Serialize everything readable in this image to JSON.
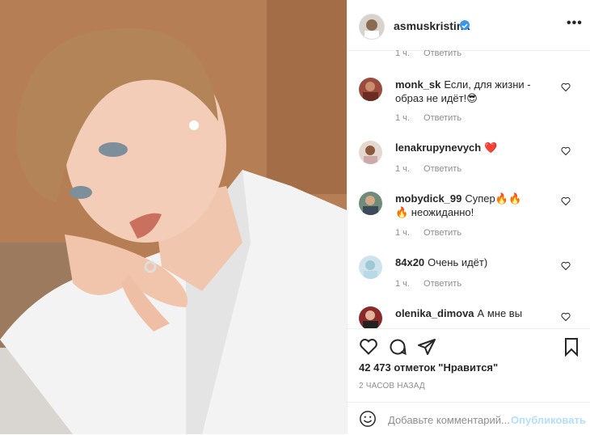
{
  "post": {
    "username": "asmuskristina",
    "more_label": "•••",
    "likes": "42 473 отметок \"Нравится\"",
    "time_ago": "2 ЧАСОВ НАЗАД",
    "add_comment_placeholder": "Добавьте комментарий...",
    "publish_label": "Опубликовать"
  },
  "comments": [
    {
      "meta_time": "1 ч.",
      "reply": "Ответить"
    },
    {
      "user": "monk_sk",
      "text": "Если, для жизни - образ не идёт!😎",
      "time": "1 ч.",
      "reply": "Ответить"
    },
    {
      "user": "lenakrupynevych",
      "text": "❤️",
      "time": "1 ч.",
      "reply": "Ответить"
    },
    {
      "user": "mobydick_99",
      "text": "Супер🔥🔥🔥 неожиданно!",
      "time": "1 ч.",
      "reply": "Ответить"
    },
    {
      "user": "84x20",
      "text": "Очень идёт)",
      "time": "1 ч.",
      "reply": "Ответить"
    },
    {
      "user": "olenika_dimova",
      "text": "А мне вы"
    }
  ],
  "colors": {
    "accent": "#3897f0",
    "heart": "#ed4956",
    "muted": "#8e8e8e"
  }
}
